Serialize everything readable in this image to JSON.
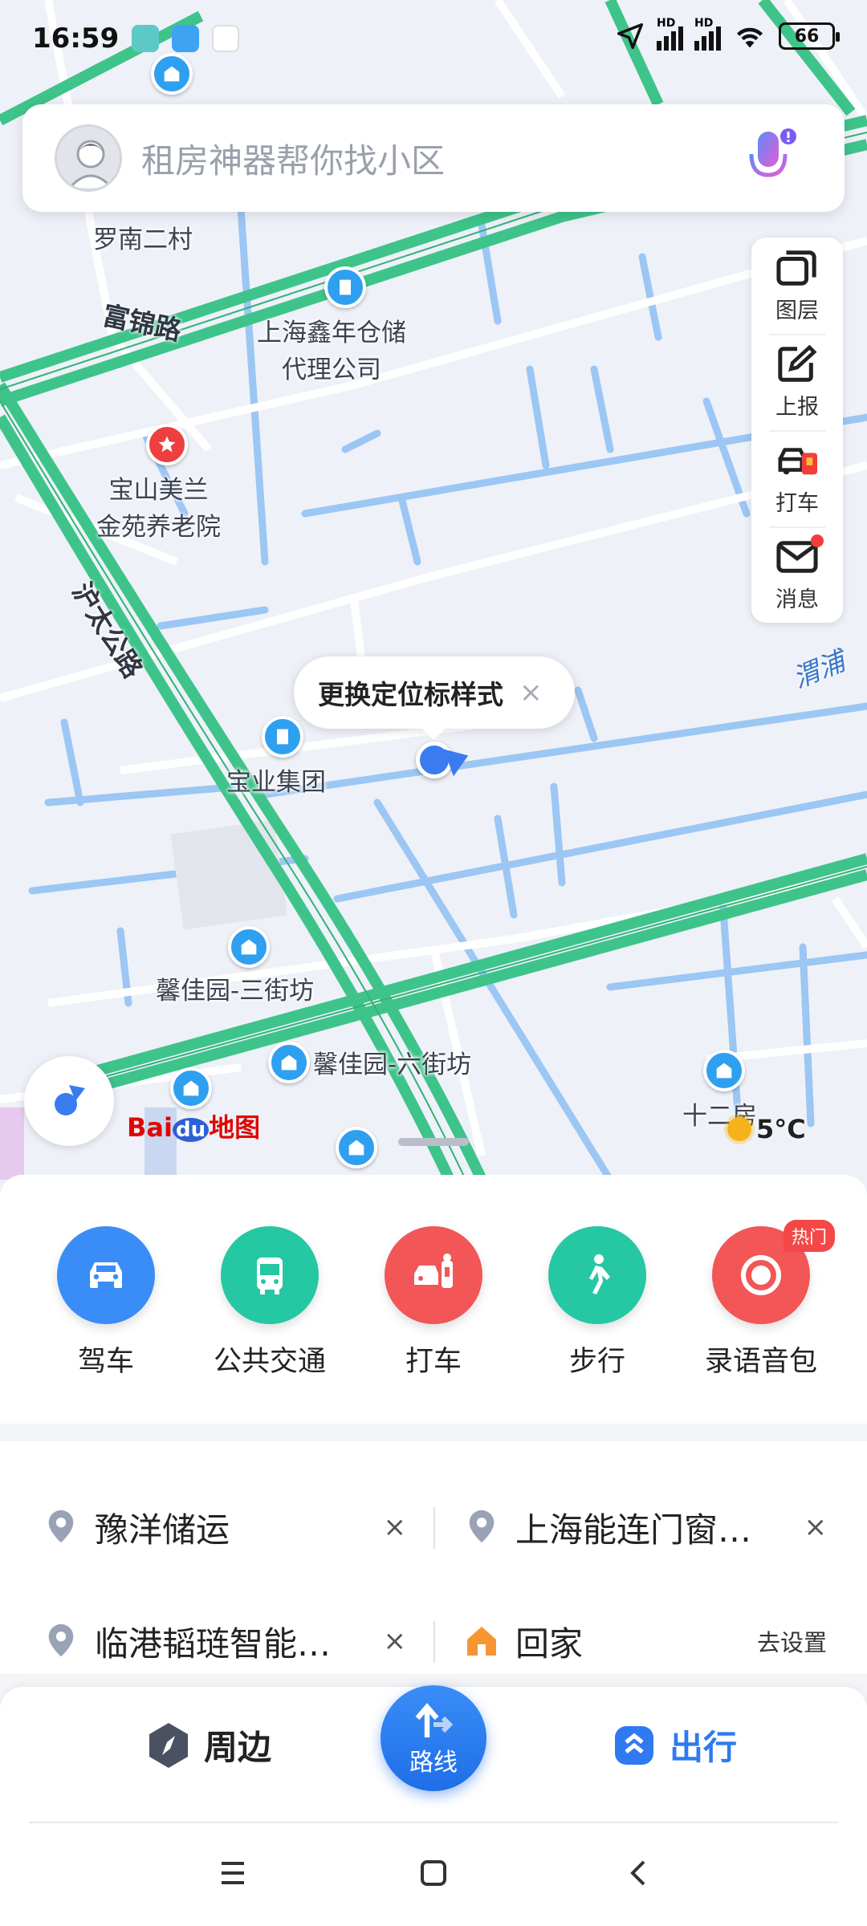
{
  "status_bar": {
    "time": "16:59",
    "battery": "66",
    "signal1": "HD",
    "signal2": "HD"
  },
  "search": {
    "placeholder": "租房神器帮你找小区"
  },
  "map_tools": [
    {
      "icon": "layers-icon",
      "label": "图层"
    },
    {
      "icon": "report-icon",
      "label": "上报"
    },
    {
      "icon": "taxi-icon",
      "label": "打车"
    },
    {
      "icon": "message-icon",
      "label": "消息"
    }
  ],
  "map": {
    "places": [
      {
        "name": "罗南二村"
      },
      {
        "name": "上海鑫年仓储\n代理公司"
      },
      {
        "name": "宝山美兰\n金苑养老院"
      },
      {
        "name": "宝业集团"
      },
      {
        "name": "馨佳园-三街坊"
      },
      {
        "name": "馨佳园-六街坊"
      },
      {
        "name": "十二房"
      }
    ],
    "roads": [
      "富锦路",
      "沪太公路"
    ],
    "rivers": [
      "渭浦"
    ],
    "location_bubble": {
      "text": "更换定位标样式",
      "close": "×"
    },
    "logo": {
      "bai": "Bai",
      "du": "du",
      "suffix": "地图"
    },
    "weather": {
      "temp": "5°C"
    }
  },
  "modes": [
    {
      "label": "驾车",
      "icon": "car-icon",
      "color": "#3a8df7"
    },
    {
      "label": "公共交通",
      "icon": "bus-icon",
      "color": "#26c7a3"
    },
    {
      "label": "打车",
      "icon": "taxi-icon",
      "color": "#f25656"
    },
    {
      "label": "步行",
      "icon": "walk-icon",
      "color": "#26c7a3"
    },
    {
      "label": "录语音包",
      "icon": "record-icon",
      "color": "#f25656",
      "badge": "热门"
    }
  ],
  "recents": [
    {
      "text": "豫洋储运",
      "action": "×"
    },
    {
      "text": "上海能连门窗…",
      "action": "×"
    },
    {
      "text": "临港韬琏智能…",
      "action": "×"
    },
    {
      "text": "回家",
      "action": "去设置"
    }
  ],
  "bottom_nav": {
    "nearby": "周边",
    "route": "路线",
    "travel": "出行"
  },
  "colors": {
    "accent": "#1f6ee8",
    "road_green": "#3ec48a",
    "water": "#9cc6f3"
  }
}
